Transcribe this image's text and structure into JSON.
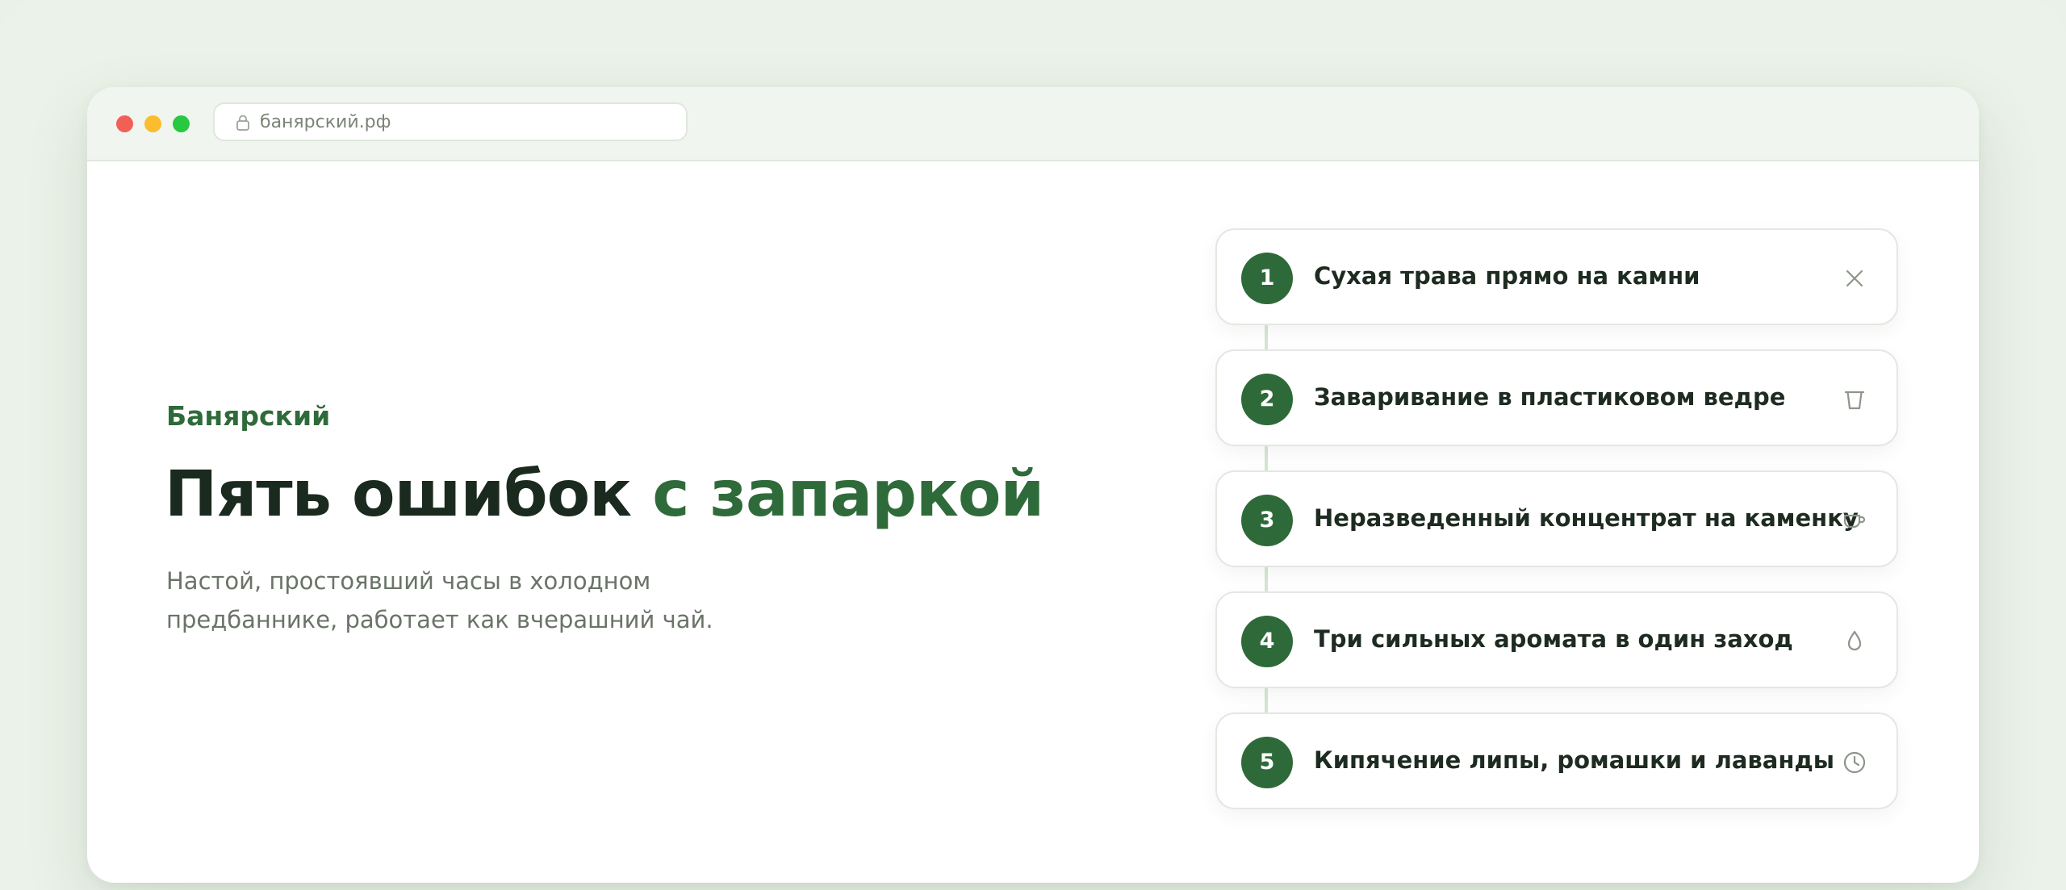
{
  "browser": {
    "url": "банярский.рф"
  },
  "hero": {
    "brand": "Банярский",
    "headline_main": "Пять ошибок",
    "headline_accent": "с запаркой",
    "subtitle": "Настой, простоявший часы в холодном предбаннике, работает как вчерашний чай."
  },
  "mistakes": [
    {
      "number": "1",
      "label": "Сухая трава прямо на камни",
      "icon": "close-icon"
    },
    {
      "number": "2",
      "label": "Заваривание в пластиковом ведре",
      "icon": "bucket-icon"
    },
    {
      "number": "3",
      "label": "Неразведенный концентрат на каменку",
      "icon": "cup-icon"
    },
    {
      "number": "4",
      "label": "Три сильных аромата в один заход",
      "icon": "drop-icon"
    },
    {
      "number": "5",
      "label": "Кипячение липы, ромашки и лаванды",
      "icon": "clock-icon"
    }
  ],
  "colors": {
    "accent": "#2f6b3a",
    "badge": "#2e6a39",
    "background": "#ebf2e9"
  }
}
